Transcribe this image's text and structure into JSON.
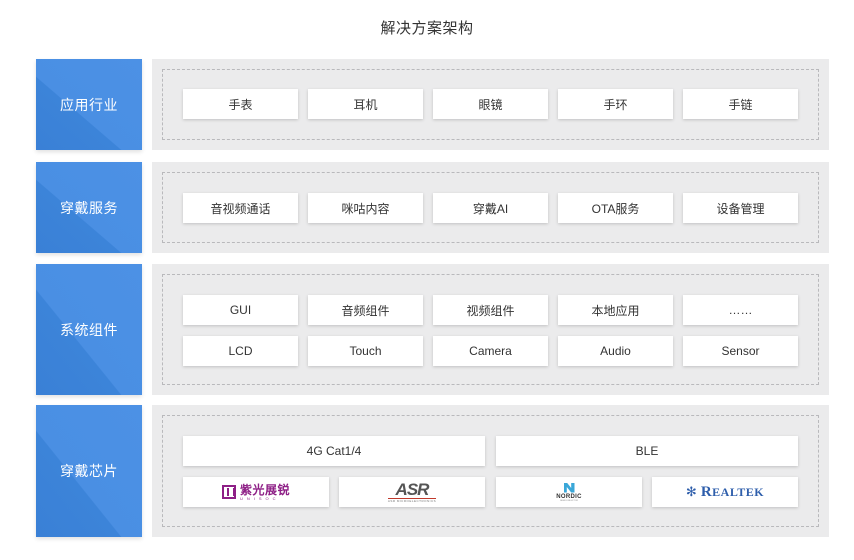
{
  "title": "解决方案架构",
  "colors": {
    "label_bg": "#4a8fe3",
    "panel_bg": "#ebebec",
    "dash": "#b9b9bc",
    "unisoc": "#8e1f86",
    "nordic": "#3aa7d8",
    "realtek": "#2e5eab"
  },
  "layers": [
    {
      "label": "应用行业",
      "rows": [
        [
          "手表",
          "耳机",
          "眼镜",
          "手环",
          "手链"
        ]
      ]
    },
    {
      "label": "穿戴服务",
      "rows": [
        [
          "音视频通话",
          "咪咕内容",
          "穿戴AI",
          "OTA服务",
          "设备管理"
        ]
      ]
    },
    {
      "label": "系统组件",
      "rows": [
        [
          "GUI",
          "音频组件",
          "视频组件",
          "本地应用",
          "……"
        ],
        [
          "LCD",
          "Touch",
          "Camera",
          "Audio",
          "Sensor"
        ]
      ]
    },
    {
      "label": "穿戴芯片",
      "categories": [
        "4G Cat1/4",
        "BLE"
      ],
      "vendors": [
        {
          "name": "unisoc-logo",
          "cn": "紫光展锐",
          "en": "UNISOC"
        },
        {
          "name": "asr-logo",
          "text": "ASR",
          "sub": "ASR MICROELECTRONICS"
        },
        {
          "name": "nordic-logo",
          "text": "NORDIC",
          "sub": "SEMICONDUCTOR"
        },
        {
          "name": "realtek-logo",
          "text_big": "R",
          "text": "EALTEK"
        }
      ]
    }
  ]
}
